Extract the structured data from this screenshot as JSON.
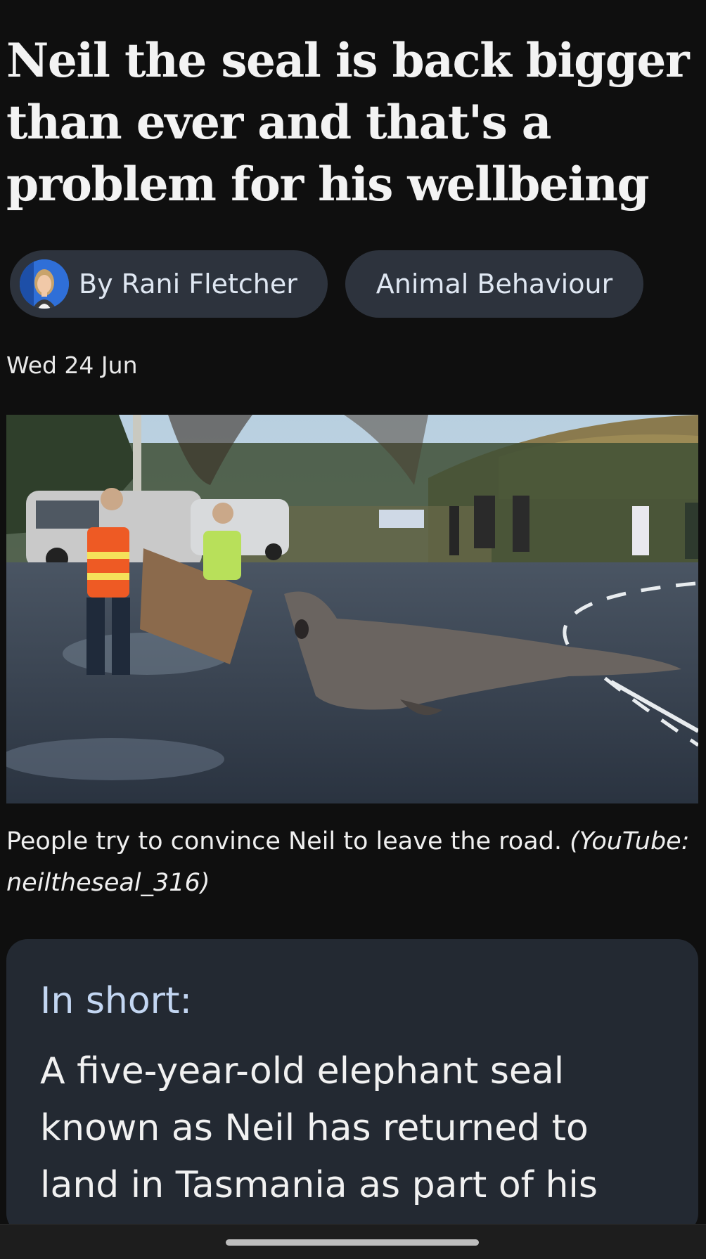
{
  "article": {
    "headline": "Neil the seal is back bigger than ever and that's a problem for his wellbeing",
    "author_label": "By Rani Fletcher",
    "topic_label": "Animal Behaviour",
    "date": "Wed 24 Jun"
  },
  "photo": {
    "caption_text": "People try to convince Neil to leave the road.",
    "caption_source": "(YouTube: neiltheseal_316)"
  },
  "summary": {
    "heading": "In short:",
    "body": "A five-year-old elephant seal known as Neil has returned to land in Tasmania as part of his"
  },
  "colors": {
    "background": "#0f0f0f",
    "pill": "#2d333d",
    "card": "#232932",
    "card_heading": "#c3d6f2"
  },
  "icons": {
    "author_avatar": "author-avatar"
  }
}
